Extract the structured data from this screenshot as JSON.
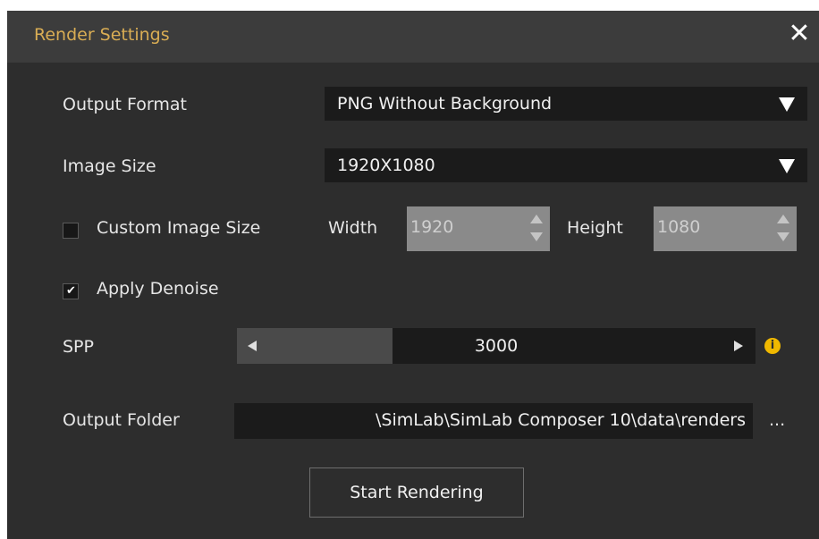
{
  "window": {
    "title": "Render Settings",
    "close_symbol": "✕"
  },
  "output_format": {
    "label": "Output Format",
    "value": "PNG Without Background"
  },
  "image_size": {
    "label": "Image Size",
    "value": "1920X1080"
  },
  "custom_size": {
    "label": "Custom Image Size",
    "checked": false,
    "width_label": "Width",
    "width_value": "1920",
    "height_label": "Height",
    "height_value": "1080"
  },
  "denoise": {
    "label": "Apply Denoise",
    "checked": true,
    "check_symbol": "✔"
  },
  "spp": {
    "label": "SPP",
    "value": "3000",
    "fill_fraction": 0.3
  },
  "info_icon_glyph": "i",
  "output_folder": {
    "label": "Output Folder",
    "path": "\\SimLab\\SimLab Composer 10\\data\\renders",
    "browse_label": "..."
  },
  "start_button": {
    "label": "Start Rendering"
  },
  "colors": {
    "background": "#2d2d2d",
    "titlebar": "#3c3c3c",
    "title_text": "#d9ad54",
    "field": "#1b1b1b",
    "disabled_field": "#8a8a8a",
    "info": "#f0b800"
  }
}
